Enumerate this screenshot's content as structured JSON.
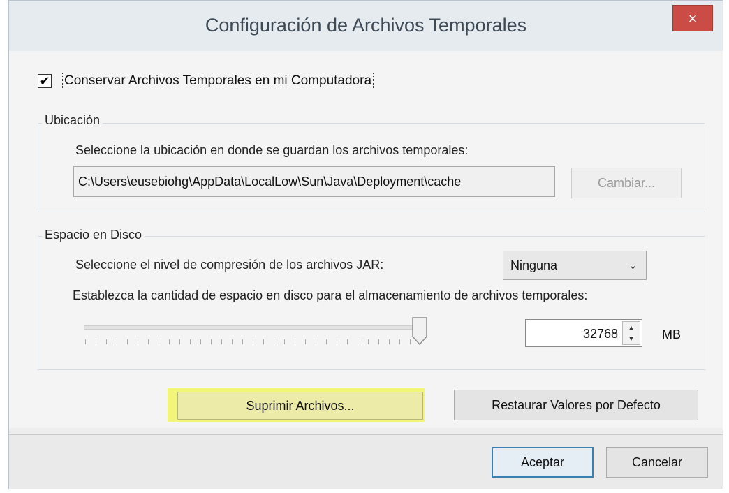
{
  "dialog": {
    "title": "Configuración de Archivos Temporales",
    "close_glyph": "×"
  },
  "keep_files": {
    "checked": true,
    "check_glyph": "✔",
    "label": "Conservar Archivos Temporales en mi Computadora"
  },
  "location": {
    "group_label": "Ubicación",
    "description": "Seleccione la ubicación en donde se guardan los archivos temporales:",
    "path": "C:\\Users\\eusebiohg\\AppData\\LocalLow\\Sun\\Java\\Deployment\\cache",
    "change_button": "Cambiar..."
  },
  "disk": {
    "group_label": "Espacio en Disco",
    "compression_label": "Seleccione el nivel de compresión de los archivos JAR:",
    "compression_value": "Ninguna",
    "space_label": "Establezca la cantidad de espacio en disco para el almacenamiento de archivos temporales:",
    "slider_level": 1.0,
    "space_value": "32768",
    "unit": "MB"
  },
  "actions": {
    "delete_files": "Suprimir Archivos...",
    "restore_defaults": "Restaurar Valores por Defecto"
  },
  "footer": {
    "accept": "Aceptar",
    "cancel": "Cancelar"
  },
  "colors": {
    "highlight": "#f3f47a",
    "close_button": "#cb4b46",
    "default_button_border": "#3c7fb1"
  }
}
